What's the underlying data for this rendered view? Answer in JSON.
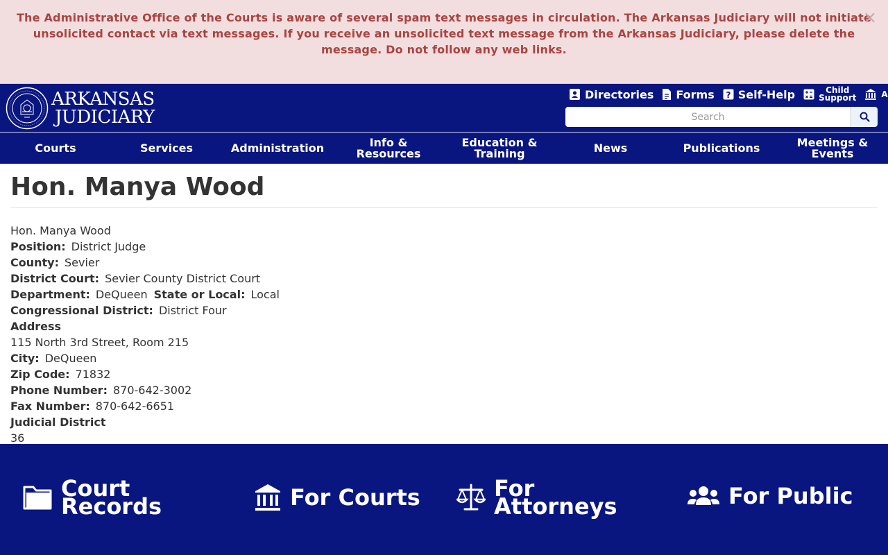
{
  "alert": {
    "message": "The Administrative Office of the Courts is aware of several spam text messages in circulation.  The Arkansas Judiciary will not initiate unsolicited contact via text messages. If you receive an unsolicited text message from the Arkansas Judiciary, please delete the message. Do not follow any web links.",
    "close": "×"
  },
  "logo": {
    "line1": "ARKANSAS",
    "line2": "JUDICIARY"
  },
  "toplinks": {
    "directories": "Directories",
    "forms": "Forms",
    "selfhelp": "Self-Help",
    "child_support_1": "Child",
    "child_support_2": "Support",
    "more": "A"
  },
  "search": {
    "placeholder": "Search"
  },
  "nav": [
    {
      "label": "Courts"
    },
    {
      "label": "Services"
    },
    {
      "label": "Administration"
    },
    {
      "label": "Info & Resources"
    },
    {
      "label": "Education & Training"
    },
    {
      "label": "News"
    },
    {
      "label": "Publications"
    },
    {
      "label": "Meetings & Events"
    }
  ],
  "page": {
    "title": "Hon. Manya Wood",
    "name": "Hon. Manya Wood",
    "position_label": "Position:",
    "position": "District Judge",
    "county_label": "County:",
    "county": "Sevier",
    "court_label": "District Court:",
    "court": "Sevier County District Court",
    "department_label": "Department:",
    "department": "DeQueen",
    "state_local_label": "State or Local:",
    "state_local": "Local",
    "congressional_label": "Congressional District:",
    "congressional": "District Four",
    "address_label": "Address",
    "address": "115 North 3rd Street, Room 215",
    "city_label": "City:",
    "city": "DeQueen",
    "zip_label": "Zip Code:",
    "zip": "71832",
    "phone_label": "Phone Number:",
    "phone": "870-642-3002",
    "fax_label": "Fax Number:",
    "fax": "870-642-6651",
    "judicial_label": "Judicial District",
    "judicial": "36"
  },
  "footer": {
    "court_records_1": "Court",
    "court_records_2": "Records",
    "for_courts": "For Courts",
    "for_attorneys_1": "For",
    "for_attorneys_2": "Attorneys",
    "for_public": "For Public"
  },
  "colors": {
    "navy": "#0a1680",
    "alert_bg": "#f2dede",
    "alert_text": "#a94442"
  }
}
